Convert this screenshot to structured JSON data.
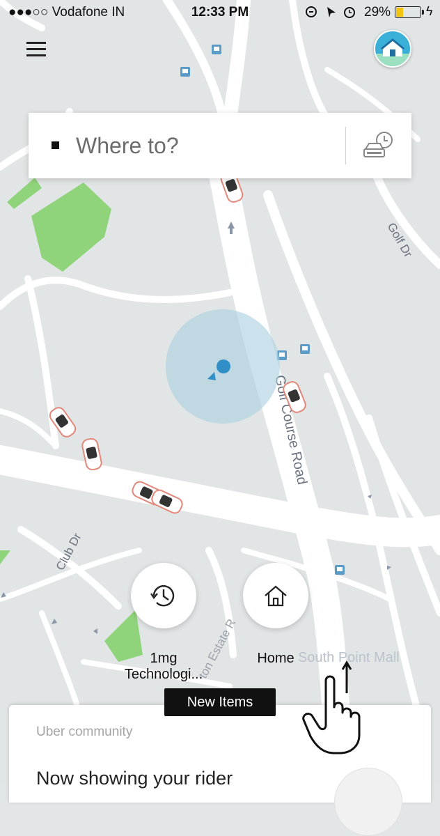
{
  "status_bar": {
    "carrier": "●●●○○ Vodafone IN",
    "time": "12:33 PM",
    "battery_percent": "29%",
    "battery_level": 0.29,
    "battery_color": "#f1c40f"
  },
  "header": {
    "menu_icon": "hamburger-menu-icon",
    "avatar_icon": "home-house-avatar-icon"
  },
  "search": {
    "placeholder": "Where to?",
    "schedule_icon": "car-clock-schedule-icon"
  },
  "map": {
    "road_labels": [
      "Golf Course Road",
      "Golf Dr",
      "Club Dr",
      "ton Estate R",
      "South Point Mall"
    ],
    "accent_location_color": "#2f8fc6",
    "park_color": "#8fd47a"
  },
  "shortcuts": [
    {
      "icon": "history-clock-icon",
      "label_line1": "1mg",
      "label_line2": "Technologi..."
    },
    {
      "icon": "home-icon",
      "label_line1": "Home"
    }
  ],
  "new_items_button": "New Items",
  "community_card": {
    "eyebrow": "Uber community",
    "headline": "Now showing your rider"
  }
}
